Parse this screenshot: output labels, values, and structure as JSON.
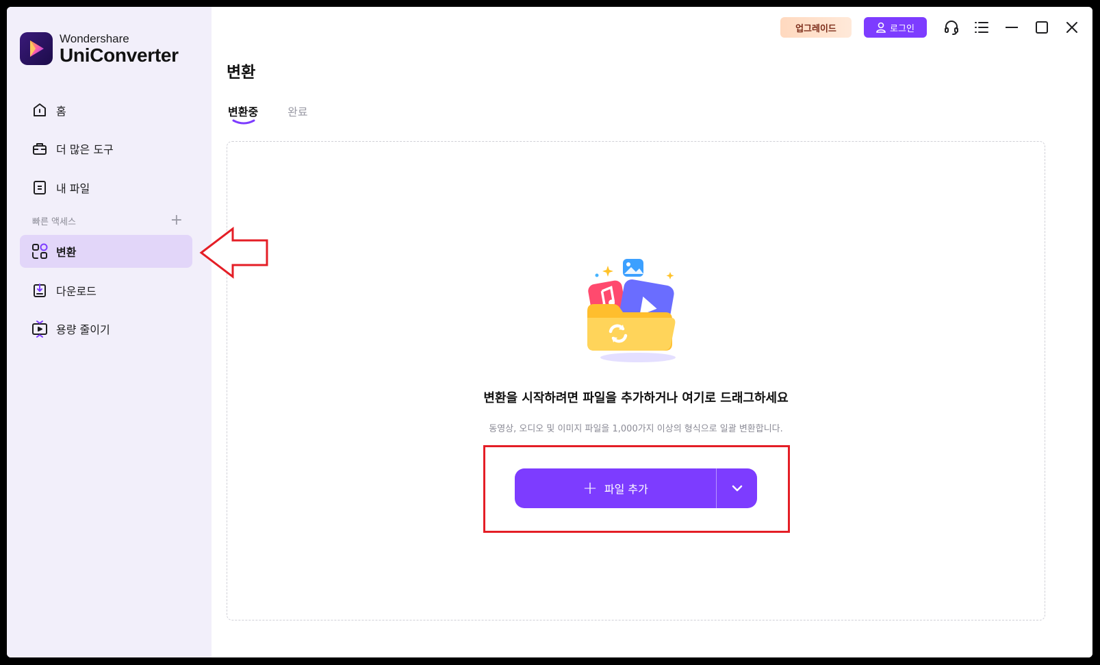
{
  "brand": {
    "company": "Wondershare",
    "product": "UniConverter"
  },
  "sidebar": {
    "items": [
      {
        "label": "홈",
        "icon": "home-icon"
      },
      {
        "label": "더 많은 도구",
        "icon": "toolbox-icon"
      },
      {
        "label": "내 파일",
        "icon": "file-icon"
      }
    ],
    "quick_access_label": "빠른 액세스",
    "quick_access_add": "+",
    "quick_items": [
      {
        "label": "변환",
        "icon": "convert-icon",
        "active": true
      },
      {
        "label": "다운로드",
        "icon": "download-icon"
      },
      {
        "label": "용량 줄이기",
        "icon": "compress-icon"
      }
    ]
  },
  "topbar": {
    "upgrade_label": "업그레이드",
    "login_label": "로그인",
    "icons": [
      "headset-icon",
      "menu-icon",
      "minimize-icon",
      "maximize-icon",
      "close-icon"
    ]
  },
  "main": {
    "title": "변환",
    "tabs": [
      {
        "label": "변환중",
        "active": true
      },
      {
        "label": "완료",
        "active": false
      }
    ],
    "dropzone": {
      "title": "변환을 시작하려면 파일을 추가하거나 여기로 드래그하세요",
      "subtitle": "동영상, 오디오 및 이미지 파일을 1,000가지 이상의 형식으로 일괄 변환합니다.",
      "add_button_label": "파일 추가",
      "add_button_plus": "+"
    }
  },
  "colors": {
    "accent": "#7d3cff",
    "sidebar_bg": "#f2effa",
    "active_item_bg": "#e2d6f9",
    "annotation_red": "#e41e26"
  }
}
